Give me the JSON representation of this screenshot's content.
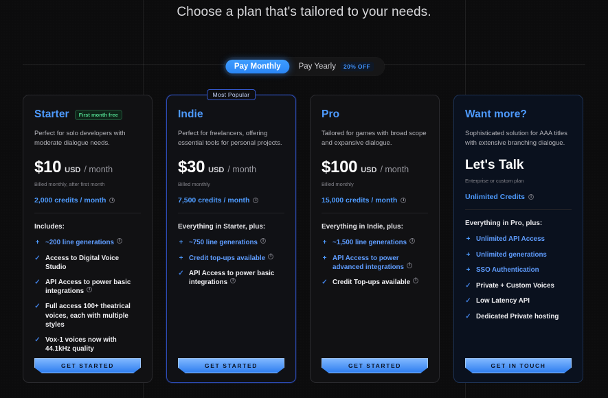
{
  "headline": "Choose a plan that's tailored to your needs.",
  "billing_toggle": {
    "monthly_label": "Pay Monthly",
    "yearly_label": "Pay Yearly",
    "discount_badge": "20% OFF",
    "active": "monthly"
  },
  "colors": {
    "accent_blue": "#4e9bff",
    "badge_green": "#4ed18a",
    "background": "#0c0c0d",
    "card_background": "#111113",
    "enterprise_background": "#0a111e"
  },
  "plans": [
    {
      "id": "starter",
      "name": "Starter",
      "badge": "First month free",
      "description": "Perfect for solo developers with moderate dialogue needs.",
      "price_amount": "$10",
      "price_currency": "USD",
      "price_period": "/ month",
      "billed_note": "Billed monthly, after first month",
      "credits": "2,000 credits / month",
      "credits_info": true,
      "includes_label": "Includes:",
      "features": [
        {
          "mark": "+",
          "text": "~200 line generations",
          "info": true
        },
        {
          "mark": "✓",
          "text": "Access to Digital Voice Studio",
          "info": false
        },
        {
          "mark": "✓",
          "text": "API Access to power basic integrations",
          "info": true
        },
        {
          "mark": "✓",
          "text": "Full access 100+ theatrical voices, each with multiple styles",
          "info": false
        },
        {
          "mark": "✓",
          "text": "Vox-1 voices now with 44.1kHz quality",
          "info": false
        }
      ],
      "cta": "GET STARTED"
    },
    {
      "id": "indie",
      "name": "Indie",
      "popular_badge": "Most Popular",
      "description": "Perfect for freelancers, offering essential tools for personal projects.",
      "price_amount": "$30",
      "price_currency": "USD",
      "price_period": "/ month",
      "billed_note": "Billed monthly",
      "credits": "7,500 credits / month",
      "credits_info": true,
      "includes_label_prefix": "Everything in ",
      "includes_label_bold": "Starter",
      "includes_label_suffix": ", plus:",
      "features": [
        {
          "mark": "+",
          "text": "~750 line generations",
          "info": true
        },
        {
          "mark": "+",
          "text": "Credit top-ups available",
          "info": true
        },
        {
          "mark": "✓",
          "text": "API Access to power basic integrations",
          "info": true
        }
      ],
      "cta": "GET STARTED"
    },
    {
      "id": "pro",
      "name": "Pro",
      "description": "Tailored for games with broad scope and expansive dialogue.",
      "price_amount": "$100",
      "price_currency": "USD",
      "price_period": "/ month",
      "billed_note": "Billed monthly",
      "credits": "15,000 credits / month",
      "credits_info": true,
      "includes_label_prefix": "Everything in ",
      "includes_label_bold": "Indie",
      "includes_label_suffix": ", plus:",
      "features": [
        {
          "mark": "+",
          "text": "~1,500 line generations",
          "info": true
        },
        {
          "mark": "+",
          "text": "API Access to power advanced integrations",
          "info": true
        },
        {
          "mark": "✓",
          "text": "Credit Top-ups available",
          "info": true
        }
      ],
      "cta": "GET STARTED"
    },
    {
      "id": "enterprise",
      "name": "Want more?",
      "description": "Sophisticated solution for AAA titles with extensive branching dialogue.",
      "price_contact": "Let's Talk",
      "billed_note": "Enterprise or custom plan",
      "credits": "Unlimited Credits",
      "credits_info": true,
      "includes_label_prefix": "Everything in ",
      "includes_label_bold": "Pro",
      "includes_label_suffix": ", plus:",
      "features": [
        {
          "mark": "+",
          "text": "Unlimited API Access",
          "info": false
        },
        {
          "mark": "+",
          "text": "Unlimited generations",
          "info": false
        },
        {
          "mark": "+",
          "text": "SSO Authentication",
          "info": false
        },
        {
          "mark": "✓",
          "text": "Private + Custom Voices",
          "info": false
        },
        {
          "mark": "✓",
          "text": "Low Latency API",
          "info": false
        },
        {
          "mark": "✓",
          "text": "Dedicated Private hosting",
          "info": false
        }
      ],
      "cta": "GET IN TOUCH"
    }
  ]
}
